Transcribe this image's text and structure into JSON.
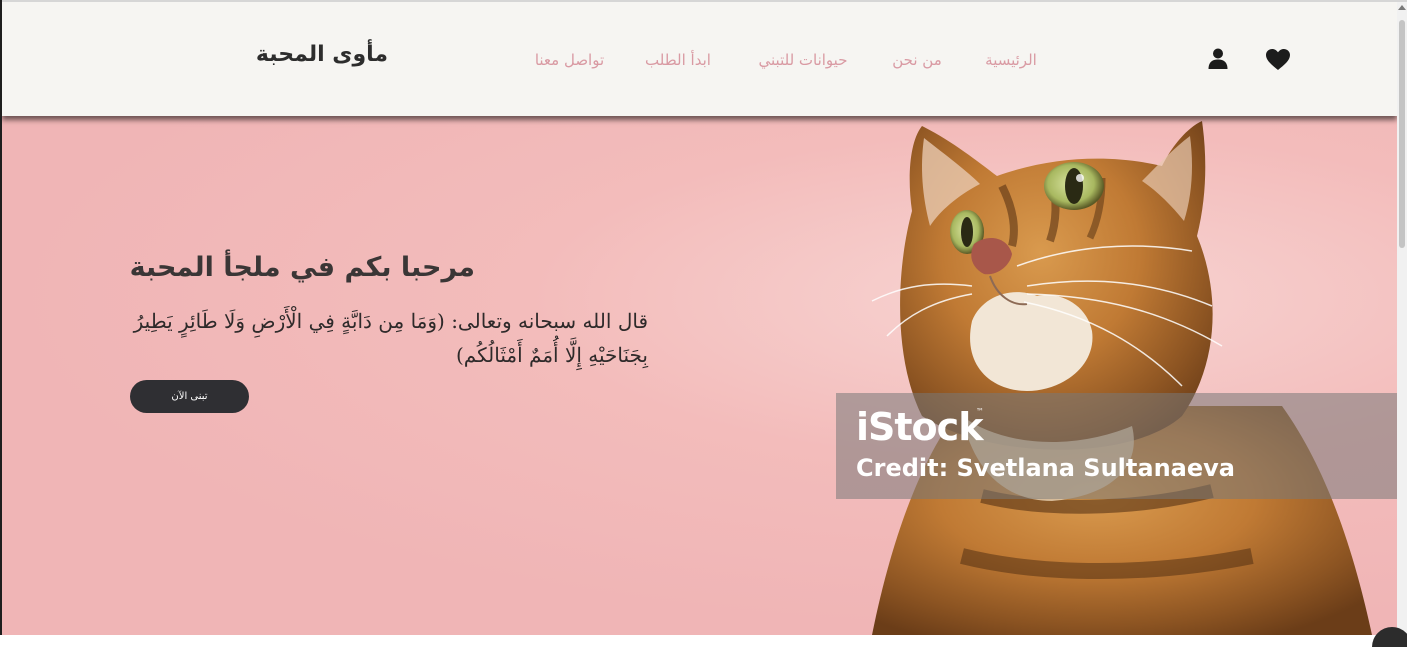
{
  "header": {
    "brand": "مأوى المحبة",
    "nav": [
      {
        "label": "الرئيسية"
      },
      {
        "label": "من نحن"
      },
      {
        "label": "حيوانات للتبني"
      },
      {
        "label": "ابدأ الطلب"
      },
      {
        "label": "تواصل معنا"
      }
    ],
    "icons": {
      "favorites": "heart-icon",
      "account": "user-icon"
    }
  },
  "hero": {
    "title": "مرحبا بكم في ملجأ المحبة",
    "quote": "قال الله سبحانه وتعالى: (وَمَا مِن دَابَّةٍ فِي الْأَرْضِ وَلَا طَائِرٍ يَطِيرُ بِجَنَاحَيْهِ إِلَّا أُمَمٌ أَمْثَالُكُم)",
    "cta_label": "تبنى الآن",
    "image_watermark": {
      "logo": "iStock",
      "tm": "™",
      "credit": "Credit: Svetlana Sultanaeva"
    }
  },
  "colors": {
    "nav_link": "#d99aa3",
    "header_bg": "#f6f5f2",
    "hero_bg": "#f0b5b6",
    "button_bg": "#2f2f33"
  }
}
